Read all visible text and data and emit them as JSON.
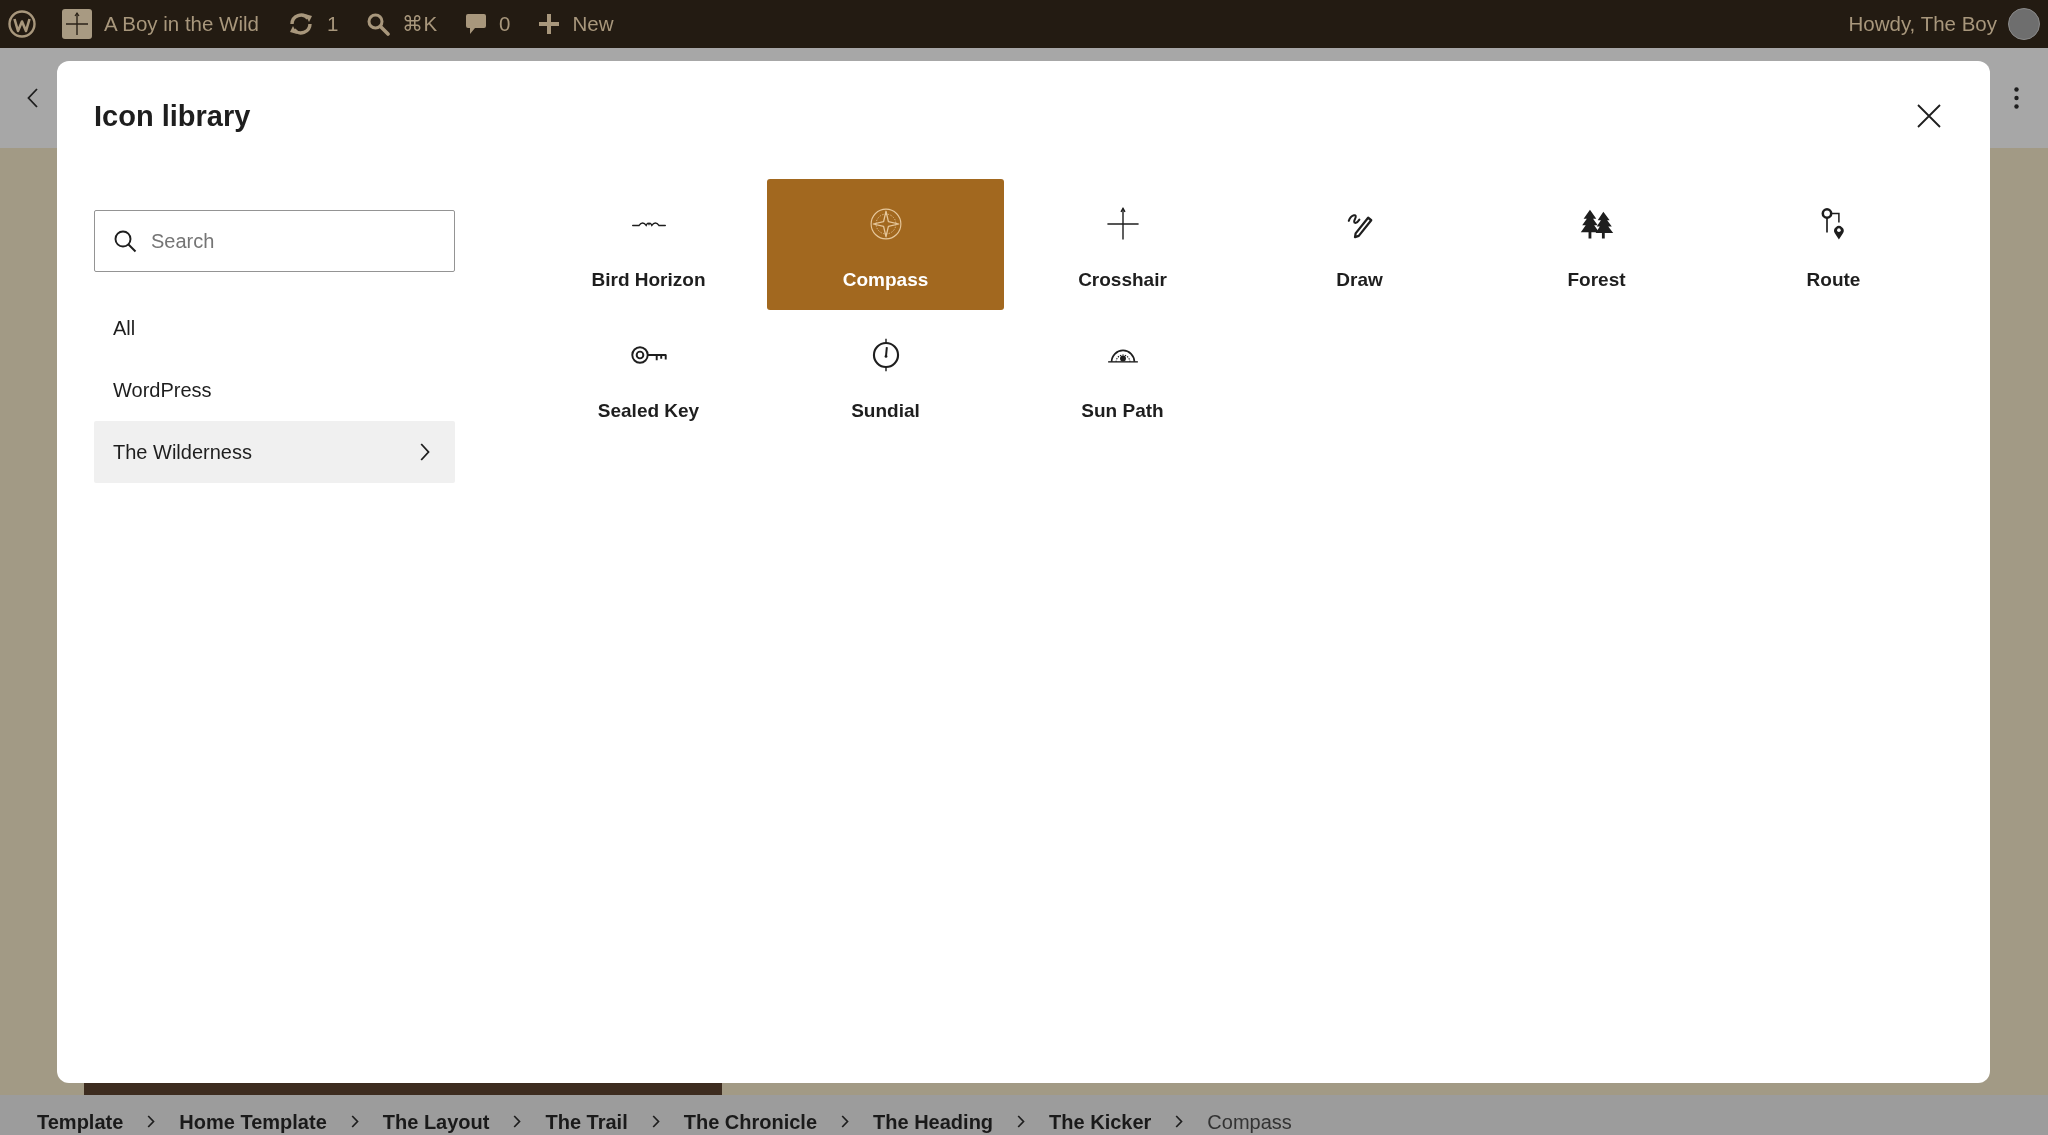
{
  "admin_bar": {
    "site_name": "A Boy in the Wild",
    "updates": "1",
    "shortcut": "⌘K",
    "comments": "0",
    "new_label": "New",
    "greeting": "Howdy, The Boy"
  },
  "modal": {
    "title": "Icon library",
    "search": {
      "placeholder": "Search"
    },
    "categories": [
      {
        "label": "All",
        "selected": false
      },
      {
        "label": "WordPress",
        "selected": false
      },
      {
        "label": "The Wilderness",
        "selected": true
      }
    ],
    "icons": [
      {
        "label": "Bird Horizon",
        "selected": false
      },
      {
        "label": "Compass",
        "selected": true
      },
      {
        "label": "Crosshair",
        "selected": false
      },
      {
        "label": "Draw",
        "selected": false
      },
      {
        "label": "Forest",
        "selected": false
      },
      {
        "label": "Route",
        "selected": false
      },
      {
        "label": "Sealed Key",
        "selected": false
      },
      {
        "label": "Sundial",
        "selected": false
      },
      {
        "label": "Sun Path",
        "selected": false
      }
    ]
  },
  "breadcrumb": [
    {
      "label": "Template",
      "current": false
    },
    {
      "label": "Home Template",
      "current": false
    },
    {
      "label": "The Layout",
      "current": false
    },
    {
      "label": "The Trail",
      "current": false
    },
    {
      "label": "The Chronicle",
      "current": false
    },
    {
      "label": "The Heading",
      "current": false
    },
    {
      "label": "The Kicker",
      "current": false
    },
    {
      "label": "Compass",
      "current": true
    }
  ]
}
